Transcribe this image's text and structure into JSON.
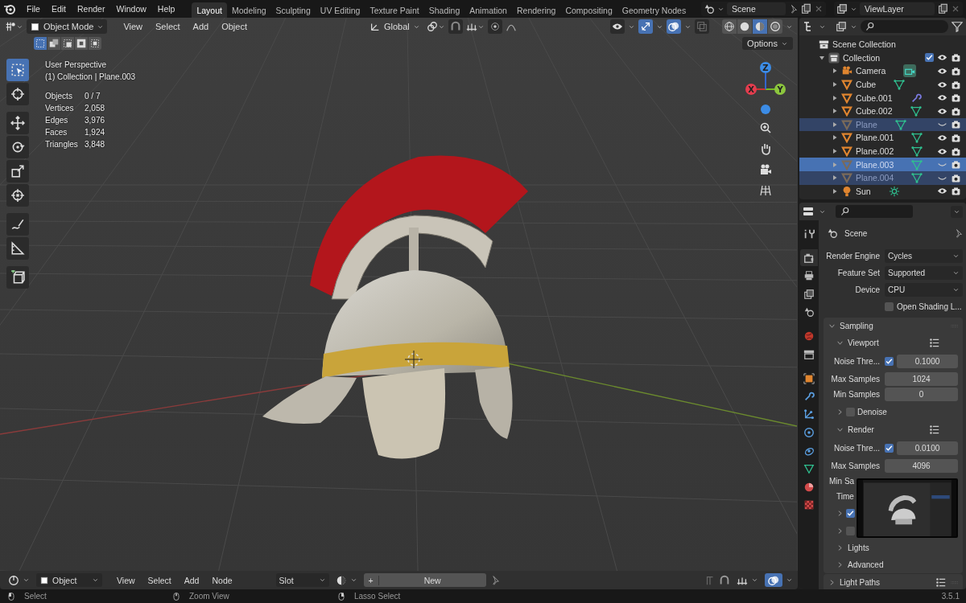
{
  "menu": [
    "File",
    "Edit",
    "Render",
    "Window",
    "Help"
  ],
  "workspaces": [
    {
      "label": "Layout",
      "selected": true
    },
    {
      "label": "Modeling",
      "selected": false
    },
    {
      "label": "Sculpting",
      "selected": false
    },
    {
      "label": "UV Editing",
      "selected": false
    },
    {
      "label": "Texture Paint",
      "selected": false
    },
    {
      "label": "Shading",
      "selected": false
    },
    {
      "label": "Animation",
      "selected": false
    },
    {
      "label": "Rendering",
      "selected": false
    },
    {
      "label": "Compositing",
      "selected": false
    },
    {
      "label": "Geometry Nodes",
      "selected": false
    }
  ],
  "scene": {
    "name": "Scene"
  },
  "view_layer": {
    "name": "ViewLayer"
  },
  "viewport": {
    "mode": "Object Mode",
    "menus": [
      "View",
      "Select",
      "Add",
      "Object"
    ],
    "orientation": "Global",
    "select_modes": [
      {
        "selected": true
      },
      {
        "selected": false
      },
      {
        "selected": false
      },
      {
        "selected": false
      },
      {
        "selected": false
      }
    ],
    "toggles": [
      {
        "kind": "visibility",
        "on": false
      },
      {
        "kind": "gizmo",
        "on": true
      },
      {
        "kind": "overlay",
        "on": true
      },
      {
        "kind": "xray",
        "on": false
      }
    ],
    "shading": [
      {
        "kind": "wireframe",
        "selected": false
      },
      {
        "kind": "solid",
        "selected": false
      },
      {
        "kind": "material",
        "selected": true
      },
      {
        "kind": "rendered",
        "selected": false
      }
    ],
    "options": "Options",
    "perspective": "User Perspective",
    "context": "(1) Collection | Plane.003",
    "stats": [
      {
        "label": "Objects",
        "value": "0 / 7"
      },
      {
        "label": "Vertices",
        "value": "2,058"
      },
      {
        "label": "Edges",
        "value": "3,976"
      },
      {
        "label": "Faces",
        "value": "1,924"
      },
      {
        "label": "Triangles",
        "value": "3,848"
      }
    ],
    "tools": [
      {
        "kind": "select",
        "selected": true
      },
      {
        "kind": "cursor",
        "selected": false
      },
      {
        "kind": "move",
        "selected": false
      },
      {
        "kind": "rotate",
        "selected": false
      },
      {
        "kind": "scale",
        "selected": false
      },
      {
        "kind": "transform",
        "selected": false
      },
      {
        "kind": "annotate",
        "selected": false
      },
      {
        "kind": "measure",
        "selected": false
      },
      {
        "kind": "add-cube",
        "selected": false
      }
    ],
    "gizmo": {
      "x": "X",
      "y": "Y",
      "z": "Z"
    }
  },
  "outliner": {
    "root": "Scene Collection",
    "collection": {
      "name": "Collection",
      "expanded": true,
      "checked": true,
      "children": [
        {
          "name": "Camera",
          "kind": "camera",
          "data": {
            "kind": "camera"
          },
          "selected": false,
          "active": false,
          "visible": true
        },
        {
          "name": "Cube",
          "kind": "mesh",
          "data": {
            "kind": "mesh"
          },
          "selected": false,
          "active": false,
          "visible": true
        },
        {
          "name": "Cube.001",
          "kind": "mesh",
          "data": {
            "kind": "modifier"
          },
          "selected": false,
          "active": false,
          "visible": true
        },
        {
          "name": "Cube.002",
          "kind": "mesh",
          "data": {
            "kind": "mesh"
          },
          "selected": false,
          "active": false,
          "visible": true
        },
        {
          "name": "Plane",
          "kind": "mesh",
          "data": {
            "kind": "mesh"
          },
          "selected": true,
          "active": false,
          "visible": false
        },
        {
          "name": "Plane.001",
          "kind": "mesh",
          "data": {
            "kind": "mesh"
          },
          "selected": false,
          "active": false,
          "visible": true
        },
        {
          "name": "Plane.002",
          "kind": "mesh",
          "data": {
            "kind": "mesh"
          },
          "selected": false,
          "active": false,
          "visible": true
        },
        {
          "name": "Plane.003",
          "kind": "mesh",
          "data": {
            "kind": "mesh"
          },
          "selected": true,
          "active": true,
          "visible": false
        },
        {
          "name": "Plane.004",
          "kind": "mesh",
          "data": {
            "kind": "mesh"
          },
          "selected": true,
          "active": false,
          "visible": false
        },
        {
          "name": "Sun",
          "kind": "light",
          "data": {
            "kind": "light"
          },
          "selected": false,
          "active": false,
          "visible": true
        }
      ]
    }
  },
  "properties": {
    "tabs": [
      {
        "kind": "tool",
        "selected": false
      },
      {
        "kind": "render",
        "selected": true
      },
      {
        "kind": "output",
        "selected": false
      },
      {
        "kind": "view-layer",
        "selected": false
      },
      {
        "kind": "scene",
        "selected": false
      },
      {
        "kind": "world",
        "selected": false
      },
      {
        "kind": "collection",
        "selected": false
      },
      {
        "kind": "object",
        "selected": false
      },
      {
        "kind": "modifiers",
        "selected": false
      },
      {
        "kind": "particles",
        "selected": false
      },
      {
        "kind": "physics",
        "selected": false
      },
      {
        "kind": "constraints",
        "selected": false
      },
      {
        "kind": "data",
        "selected": false
      },
      {
        "kind": "material",
        "selected": false
      },
      {
        "kind": "texture",
        "selected": false
      }
    ],
    "context": "Scene",
    "fields": [
      {
        "label": "Render Engine",
        "value": "Cycles"
      },
      {
        "label": "Feature Set",
        "value": "Supported"
      },
      {
        "label": "Device",
        "value": "CPU"
      }
    ],
    "open_shading": {
      "label": "Open Shading L...",
      "checked": false
    },
    "panels": [
      {
        "title": "Sampling",
        "expanded": true,
        "presets": false,
        "items": [
          {
            "kind": "subpanel",
            "title": "Viewport",
            "expanded": true,
            "presets": true
          },
          {
            "kind": "check_number",
            "label": "Noise Thre...",
            "checked": true,
            "value": "0.1000"
          },
          {
            "kind": "number",
            "label": "Max Samples",
            "value": "1024"
          },
          {
            "kind": "number",
            "label": "Min Samples",
            "value": "0"
          },
          {
            "kind": "check_subpanel",
            "label": "Denoise",
            "checked": false,
            "expanded": false
          },
          {
            "kind": "subpanel",
            "title": "Render",
            "expanded": true,
            "presets": true
          },
          {
            "kind": "check_number",
            "label": "Noise Thre...",
            "checked": true,
            "value": "0.0100"
          },
          {
            "kind": "number",
            "label": "Max Samples",
            "value": "4096"
          },
          {
            "kind": "label",
            "label": "Min Sa"
          },
          {
            "kind": "label",
            "label": "Time"
          },
          {
            "kind": "check_subpanel",
            "checked": true,
            "expanded": false
          },
          {
            "kind": "check_subpanel",
            "checked": false,
            "expanded": false
          },
          {
            "kind": "subpanel",
            "title": "Lights",
            "expanded": false,
            "presets": false
          },
          {
            "kind": "subpanel",
            "title": "Advanced",
            "expanded": false,
            "presets": false
          }
        ]
      },
      {
        "title": "Light Paths",
        "expanded": false,
        "presets": true
      }
    ]
  },
  "timeline": {
    "mode": "Object",
    "menus": [
      "View",
      "Select",
      "Add",
      "Node"
    ],
    "slot": "Slot",
    "new_icon": "+",
    "new_label": "New"
  },
  "status": {
    "items": [
      {
        "kind": "left",
        "label": "Select"
      },
      {
        "kind": "middle",
        "label": "Zoom View"
      },
      {
        "kind": "right",
        "label": "Lasso Select"
      }
    ],
    "version": "3.5.1"
  }
}
